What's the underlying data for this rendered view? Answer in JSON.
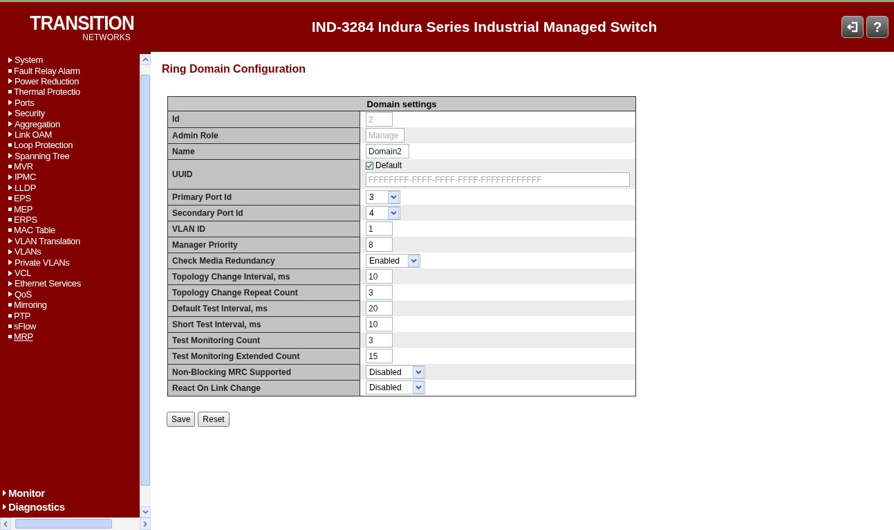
{
  "header": {
    "logo_main": "TRANSITION",
    "logo_sub": "NETWORKS",
    "title": "IND-3284 Indura Series Industrial Managed Switch",
    "buttons": [
      {
        "kind": "logout"
      },
      {
        "kind": "help",
        "label": "?"
      }
    ]
  },
  "sidebar": {
    "items": [
      {
        "label": "System",
        "kind": "arrow",
        "selected": false
      },
      {
        "label": "Fault Relay Alarm",
        "kind": "bullet",
        "selected": false
      },
      {
        "label": "Power Reduction",
        "kind": "arrow",
        "selected": false
      },
      {
        "label": "Thermal Protectio",
        "kind": "bullet",
        "selected": false
      },
      {
        "label": "Ports",
        "kind": "arrow",
        "selected": false
      },
      {
        "label": "Security",
        "kind": "arrow",
        "selected": false
      },
      {
        "label": "Aggregation",
        "kind": "arrow",
        "selected": false
      },
      {
        "label": "Link OAM",
        "kind": "arrow",
        "selected": false
      },
      {
        "label": "Loop Protection",
        "kind": "bullet",
        "selected": false
      },
      {
        "label": "Spanning Tree",
        "kind": "arrow",
        "selected": false
      },
      {
        "label": "MVR",
        "kind": "bullet",
        "selected": false
      },
      {
        "label": "IPMC",
        "kind": "arrow",
        "selected": false
      },
      {
        "label": "LLDP",
        "kind": "arrow",
        "selected": false
      },
      {
        "label": "EPS",
        "kind": "bullet",
        "selected": false
      },
      {
        "label": "MEP",
        "kind": "bullet",
        "selected": false
      },
      {
        "label": "ERPS",
        "kind": "bullet",
        "selected": false
      },
      {
        "label": "MAC Table",
        "kind": "bullet",
        "selected": false
      },
      {
        "label": "VLAN Translation",
        "kind": "arrow",
        "selected": false
      },
      {
        "label": "VLANs",
        "kind": "arrow",
        "selected": false
      },
      {
        "label": "Private VLANs",
        "kind": "arrow",
        "selected": false
      },
      {
        "label": "VCL",
        "kind": "arrow",
        "selected": false
      },
      {
        "label": "Ethernet Services",
        "kind": "arrow",
        "selected": false
      },
      {
        "label": "QoS",
        "kind": "arrow",
        "selected": false
      },
      {
        "label": "Mirroring",
        "kind": "bullet",
        "selected": false
      },
      {
        "label": "PTP",
        "kind": "bullet",
        "selected": false
      },
      {
        "label": "sFlow",
        "kind": "bullet",
        "selected": false
      },
      {
        "label": "MRP",
        "kind": "bullet",
        "selected": true
      }
    ],
    "sections": [
      {
        "label": "Monitor"
      },
      {
        "label": "Diagnostics"
      }
    ]
  },
  "page": {
    "title": "Ring Domain Configuration",
    "table": {
      "heading": "Domain settings",
      "rows": [
        {
          "label": "Id",
          "kind": "text",
          "value": "2",
          "disabled": true
        },
        {
          "label": "Admin Role",
          "kind": "text",
          "value": "Manage",
          "disabled": true
        },
        {
          "label": "Name",
          "kind": "text",
          "value": "Domain2",
          "disabled": false
        },
        {
          "label": "UUID",
          "kind": "uuid",
          "checkbox_label": "Default",
          "checked": true,
          "value": "FFFFFFFF-FFFF-FFFF-FFFF-FFFFFFFFFFFF",
          "disabled": true
        },
        {
          "label": "Primary Port Id",
          "kind": "select",
          "value": "3"
        },
        {
          "label": "Secondary Port Id",
          "kind": "select",
          "value": "4"
        },
        {
          "label": "VLAN ID",
          "kind": "text",
          "value": "1",
          "disabled": false
        },
        {
          "label": "Manager Priority",
          "kind": "text",
          "value": "8",
          "disabled": false
        },
        {
          "label": "Check Media Redundancy",
          "kind": "select",
          "value": "Enabled"
        },
        {
          "label": "Topology Change Interval, ms",
          "kind": "text",
          "value": "10",
          "disabled": false
        },
        {
          "label": "Topology Change Repeat Count",
          "kind": "text",
          "value": "3",
          "disabled": false
        },
        {
          "label": "Default Test Interval, ms",
          "kind": "text",
          "value": "20",
          "disabled": false
        },
        {
          "label": "Short Test Interval, ms",
          "kind": "text",
          "value": "10",
          "disabled": false
        },
        {
          "label": "Test Monitoring Count",
          "kind": "text",
          "value": "3",
          "disabled": false
        },
        {
          "label": "Test Monitoring Extended Count",
          "kind": "text",
          "value": "15",
          "disabled": false
        },
        {
          "label": "Non-Blocking MRC Supported",
          "kind": "select",
          "value": "Disabled"
        },
        {
          "label": "React On Link Change",
          "kind": "select",
          "value": "Disabled"
        }
      ]
    },
    "buttons": [
      "Save",
      "Reset"
    ]
  }
}
